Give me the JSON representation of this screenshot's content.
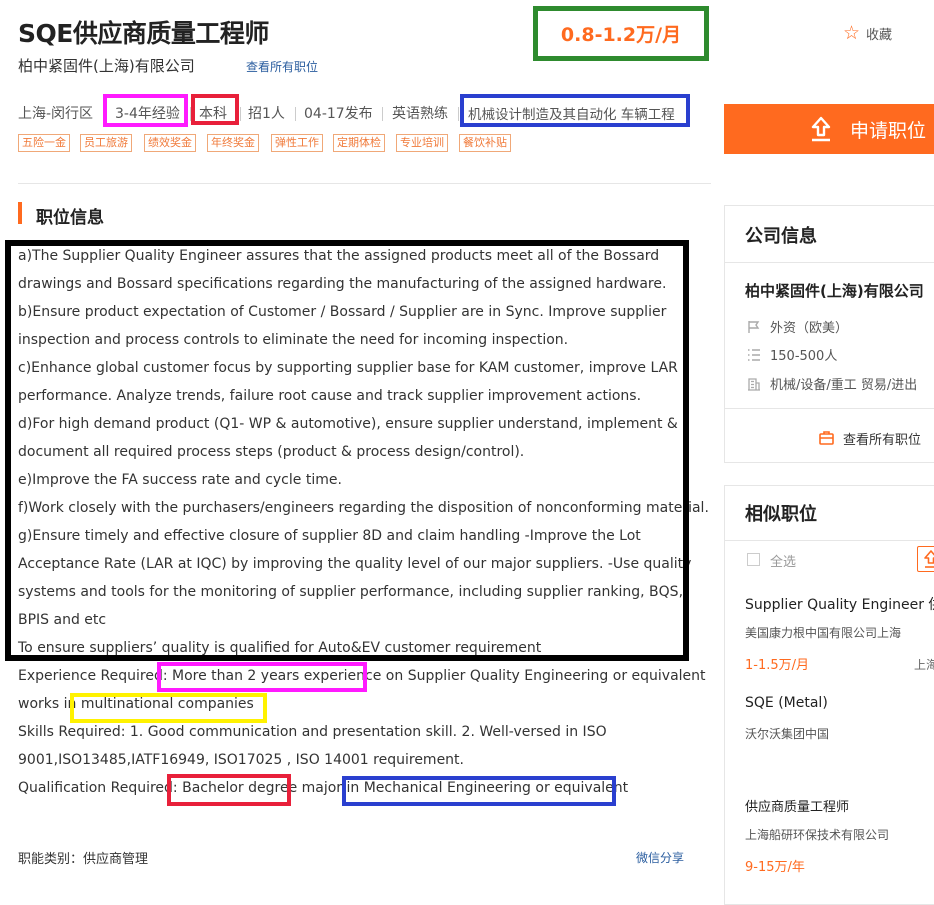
{
  "job": {
    "title": "SQE供应商质量工程师",
    "company": "柏中紧固件(上海)有限公司",
    "view_all_jobs": "查看所有职位",
    "salary": "0.8-1.2万/月",
    "favorite_label": "收藏",
    "apply_label": "申请职位"
  },
  "meta": {
    "location": "上海-闵行区",
    "experience": "3-4年经验",
    "education": "本科",
    "headcount": "招1人",
    "posted": "04-17发布",
    "language": "英语熟练",
    "industry": "机械设计制造及其自动化 车辆工程"
  },
  "welfare_tags": [
    "五险一金",
    "员工旅游",
    "绩效奖金",
    "年终奖金",
    "弹性工作",
    "定期体检",
    "专业培训",
    "餐饮补贴"
  ],
  "section": {
    "title": "职位信息"
  },
  "description_lines": [
    " a)The Supplier Quality Engineer assures that the assigned products meet all of the Bossard",
    "drawings and Bossard specifications regarding the manufacturing of the assigned hardware.",
    "b)Ensure product expectation of Customer / Bossard / Supplier are in Sync. Improve supplier",
    "inspection and process controls to eliminate the need for incoming inspection.",
    "c)Enhance global customer focus by supporting supplier base for KAM customer, improve LAR",
    "performance. Analyze trends, failure root cause and track supplier improvement actions.",
    "d)For high demand product (Q1- WP & automotive), ensure supplier understand, implement &",
    "document all required process steps (product & process design/control).",
    "e)Improve the FA success rate and cycle time.",
    "f)Work closely with the purchasers/engineers regarding the disposition of nonconforming material.",
    "g)Ensure timely and effective closure of supplier 8D and claim handling -Improve the Lot",
    "Acceptance Rate (LAR at IQC) by improving the quality level of our major suppliers. -Use quality",
    "systems and tools for the monitoring of supplier performance, including supplier ranking, BQS,",
    "BPIS and etc",
    "To ensure suppliers’   quality is qualified for Auto&EV customer requirement",
    "Experience Required: More than 2 years experience on Supplier Quality Engineering or equivalent",
    "works in multinational companies",
    "Skills Required: 1. Good communication and presentation skill. 2. Well-versed in ISO",
    "9001,ISO13485,IATF16949, ISO17025 , ISO 14001 requirement.",
    "Qualification Required: Bachelor degree major in Mechanical Engineering or equivalent"
  ],
  "footer": {
    "category": "职能类别：供应商管理",
    "share": "微信分享"
  },
  "company_info": {
    "title": "公司信息",
    "name": "柏中紧固件(上海)有限公司",
    "type": "外资（欧美）",
    "size": "150-500人",
    "industry": "机械/设备/重工 贸易/进出",
    "view_all": "查看所有职位"
  },
  "similar_jobs": {
    "title": "相似职位",
    "select_all": "全选",
    "items": [
      {
        "title": "Supplier Quality Engineer 供",
        "company": "美国康力根中国有限公司上海",
        "salary": "1-1.5万/月",
        "location": "上海"
      },
      {
        "title": "SQE (Metal)",
        "company": "沃尔沃集团中国",
        "salary": "",
        "location": ""
      },
      {
        "title": "供应商质量工程师",
        "company": "上海船研环保技术有限公司",
        "salary": "9-15万/年",
        "location": ""
      }
    ]
  },
  "colors": {
    "accent": "#ff6a1f",
    "link": "#2a5d9f",
    "highlight_green": "#2e8b2e",
    "highlight_magenta": "#ff1aff",
    "highlight_red": "#e8203a",
    "highlight_blue": "#2a3fcf",
    "highlight_yellow": "#fff200",
    "highlight_black": "#000000"
  }
}
